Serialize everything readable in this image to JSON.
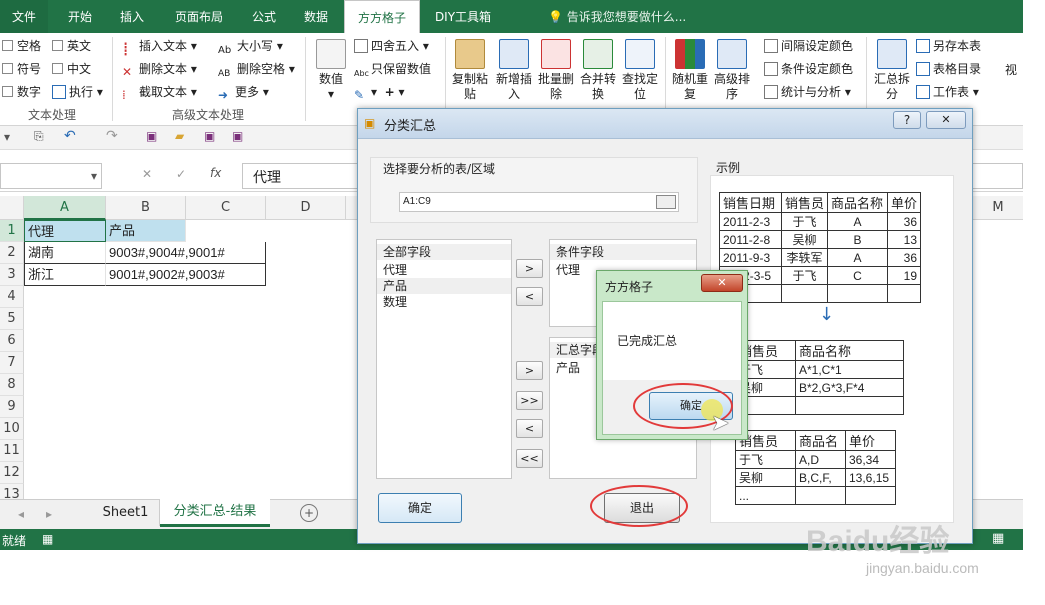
{
  "ribbon_tabs": [
    "文件",
    "开始",
    "插入",
    "页面布局",
    "公式",
    "数据",
    "方方格子",
    "DIY工具箱"
  ],
  "active_tab": "方方格子",
  "tell_me": "告诉我您想要做什么...",
  "ribbon": {
    "checks": [
      "空格",
      "英文",
      "符号",
      "中文",
      "数字"
    ],
    "exec": "执行",
    "text_tools": [
      "插入文本",
      "删除文本",
      "截取文本"
    ],
    "case_tools": [
      "大小写",
      "删除空格",
      "更多"
    ],
    "group_text": "文本处理",
    "group_adv_text": "高级文本处理",
    "value_btn": "数值",
    "value_tools": [
      "四舍五入",
      "只保留数值"
    ],
    "big_buttons": [
      "复制粘\n贴",
      "新增插\n入",
      "批量删\n除",
      "合并转\n换",
      "查找定\n位",
      "随机重\n复",
      "高级排\n序"
    ],
    "right_tools": [
      "间隔设定颜色",
      "条件设定颜色",
      "统计与分析"
    ],
    "summary_btn": "汇总拆\n分",
    "far_right": [
      "另存本表",
      "表格目录",
      "工作表"
    ],
    "view_btn": "视"
  },
  "formula_bar": {
    "cell_ref": "",
    "fx": "fx",
    "value": "代理"
  },
  "columns": [
    "A",
    "B",
    "C",
    "D"
  ],
  "rows": [
    "1",
    "2",
    "3",
    "4",
    "5",
    "6",
    "7",
    "8",
    "9",
    "10",
    "11",
    "12",
    "13"
  ],
  "cells": [
    [
      "代理",
      "产品"
    ],
    [
      "湖南",
      "9003#,9004#,9001#"
    ],
    [
      "浙江",
      "9001#,9002#,9003#"
    ]
  ],
  "extra_col_letter": "M",
  "sheets": [
    "Sheet1",
    "分类汇总-结果"
  ],
  "active_sheet": "分类汇总-结果",
  "status": "就绪",
  "dialog": {
    "title": "分类汇总",
    "help": "?",
    "close": "✕",
    "range_label": "选择要分析的表/区域",
    "range_value": "A1:C9",
    "all_fields_label": "全部字段",
    "all_fields": [
      "代理",
      "产品",
      "数理"
    ],
    "cond_label": "条件字段",
    "cond_fields": [
      "代理"
    ],
    "summary_label": "汇总字段",
    "summary_fields": [
      "产品"
    ],
    "ok": "确定",
    "exit": "退出",
    "example_label": "示例",
    "example1": [
      [
        "销售日期",
        "销售员",
        "商品名称",
        "单价"
      ],
      [
        "2011-2-3",
        "于飞",
        "A",
        "36"
      ],
      [
        "2011-2-8",
        "吴柳",
        "B",
        "13"
      ],
      [
        "2011-9-3",
        "李轶军",
        "A",
        "36"
      ],
      [
        "2012-3-5",
        "于飞",
        "C",
        "19"
      ],
      [
        "",
        "",
        "",
        ""
      ]
    ],
    "example2": [
      [
        "销售员",
        "商品名称"
      ],
      [
        "于飞",
        "A*1,C*1"
      ],
      [
        "吴柳",
        "B*2,G*3,F*4"
      ],
      [
        "",
        ""
      ]
    ],
    "example3": [
      [
        "销售员",
        "商品名",
        "单价"
      ],
      [
        "于飞",
        "A,D",
        "36,34"
      ],
      [
        "吴柳",
        "B,C,F,",
        "13,6,15"
      ],
      [
        "...",
        "",
        ""
      ]
    ]
  },
  "msgbox": {
    "title": "方方格子",
    "message": "已完成汇总",
    "ok": "确定"
  },
  "watermark": {
    "brand": "Baidu经验",
    "url": "jingyan.baidu.com"
  },
  "colors": {
    "excel_green": "#217346",
    "msg_green": "#c9e8c9",
    "highlight": "#e23a3a"
  }
}
